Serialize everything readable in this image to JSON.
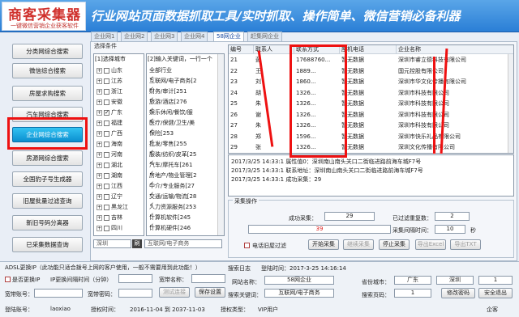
{
  "header": {
    "logo_title": "商客采集器",
    "logo_sub": "一键微信营销企业获客软件",
    "banner": "行业网站页面数据抓取工具/实时抓取、操作简单、微信营销必备利器"
  },
  "nav": {
    "items": [
      "分类网综合搜索",
      "微信综合搜索",
      "房屋求购搜索",
      "汽车网综合搜索",
      "企业网综合搜索",
      "房源网综合搜索",
      "全国豹子号生成器",
      "旧屋批量过滤查询",
      "新旧号码分离器",
      "已采集数据查询"
    ],
    "active_index": 4
  },
  "tabs": [
    "企业网1",
    "企业网2",
    "企业网3",
    "企业网4",
    "58网企业",
    "赶集网企业"
  ],
  "active_tab": 4,
  "select_condition_label": "选择条件",
  "cities": {
    "header": "[1]选择城市",
    "items": [
      {
        "name": "山东",
        "checked": false
      },
      {
        "name": "江苏",
        "checked": false
      },
      {
        "name": "浙江",
        "checked": false
      },
      {
        "name": "安徽",
        "checked": false
      },
      {
        "name": "广东",
        "checked": true
      },
      {
        "name": "福建",
        "checked": false
      },
      {
        "name": "广西",
        "checked": false
      },
      {
        "name": "海南",
        "checked": false
      },
      {
        "name": "河南",
        "checked": false
      },
      {
        "name": "湖北",
        "checked": false
      },
      {
        "name": "湖南",
        "checked": false
      },
      {
        "name": "江西",
        "checked": false
      },
      {
        "name": "辽宁",
        "checked": false
      },
      {
        "name": "黑龙江",
        "checked": false
      },
      {
        "name": "吉林",
        "checked": false
      },
      {
        "name": "四川",
        "checked": false
      }
    ],
    "search_value": "深圳",
    "search_badge": "刷"
  },
  "industries": {
    "header": "[2]输入关键词，一行一个",
    "items": [
      {
        "name": "全部行业",
        "checked": false
      },
      {
        "name": "互联网/电子商务[2",
        "checked": true
      },
      {
        "name": "财务/审计[251",
        "checked": true
      },
      {
        "name": "旅游/酒店[276",
        "checked": true
      },
      {
        "name": "娱乐休闲/餐饮/服",
        "checked": true
      },
      {
        "name": "医疗/保健/卫生/美",
        "checked": true
      },
      {
        "name": "保险[253",
        "checked": true
      },
      {
        "name": "批发/零售[255",
        "checked": true
      },
      {
        "name": "服装/纺织/皮革[25",
        "checked": true
      },
      {
        "name": "汽车/摩托车[261",
        "checked": true
      },
      {
        "name": "房地产/物业管理[2",
        "checked": true
      },
      {
        "name": "中介/专业服务[27",
        "checked": true
      },
      {
        "name": "交通/运输/物流[28",
        "checked": true
      },
      {
        "name": "人力资源服务[253",
        "checked": true
      },
      {
        "name": "计算机软件[245",
        "checked": true
      },
      {
        "name": "计算机硬件[246",
        "checked": true
      }
    ],
    "keyword_value": "互联网/电子商务"
  },
  "table": {
    "columns": [
      "编号",
      "联系人",
      "联系方式",
      "座机电话",
      "企业名称"
    ],
    "rows": [
      [
        "21",
        "彭",
        "17688760...",
        "暂无数据",
        "深圳市睿立德科技有限公司"
      ],
      [
        "22",
        "王",
        "1889...",
        "暂无数据",
        "国元控股有限公司"
      ],
      [
        "23",
        "刘",
        "1860...",
        "暂无数据",
        "深圳市华文化传播有限公司"
      ],
      [
        "24",
        "胡",
        "1326...",
        "暂无数据",
        "深圳市科技有限公司"
      ],
      [
        "25",
        "朱",
        "1326...",
        "暂无数据",
        "深圳市科技有限公司"
      ],
      [
        "26",
        "谢",
        "1326...",
        "暂无数据",
        "深圳市科技有限公司"
      ],
      [
        "27",
        "朱",
        "1326...",
        "暂无数据",
        "深圳市科技有限公司"
      ],
      [
        "28",
        "郑",
        "1596...",
        "暂无数据",
        "深圳市快乐礼品有限公司"
      ],
      [
        "29",
        "张",
        "1326...",
        "暂无数据",
        "深圳文化传播有限公司"
      ]
    ]
  },
  "log": [
    "2017/3/25 14:33:1  属性值0：深圳南山南头关口二街临进路前海车城F7号",
    "2017/3/25 14:33:1  联系地址：深圳南山南头关口二街临进路前海车城F7号",
    "2017/3/25 14:33:1  成功采集：29"
  ],
  "operation": {
    "title": "采集操作",
    "success_label": "成功采集：",
    "success_value": "29",
    "filtered_label": "已过滤重复数：",
    "filtered_value": "2",
    "current_value": "39",
    "interval_label": "采集间隔时间：",
    "interval_value": "10",
    "interval_unit": "秒",
    "buttons": {
      "start": "开始采集",
      "continue": "继续采集",
      "stop": "停止采集",
      "export_excel": "导出Excel",
      "export_txt": "导出TXT"
    },
    "filter_checkbox_label": "电话旧屋过滤"
  },
  "bottom": {
    "adsl_notice": "ADSL更换IP（此功能只适合拨号上网的客户使用，一般不需要用到此功能！）",
    "auto_change_ip_label": "是否更换IP",
    "ip_interval_label": "IP更换间隔时间（分钟）",
    "broadband_name_label": "宽带名称：",
    "broadband_account_label": "宽带账号：",
    "broadband_password_label": "宽带密码：",
    "test_connect_label": "测试连接",
    "save_settings_label": "保存设置",
    "search_log_label": "搜索日志",
    "search_log_value": "登陆时间：2017-3-25 14:16:14",
    "site_name_label": "网站名称：",
    "site_name_value": "58网企业",
    "province_label": "省份城市：",
    "province_value": "广东",
    "city_value": "深圳",
    "city_page": "1",
    "keyword_label": "搜索关键词：",
    "keyword_value": "互联网/电子商务",
    "page_label": "搜索页码：",
    "page_value": "1",
    "change_password_label": "修改密码",
    "logout_label": "安全退出",
    "login_account_label": "登陆账号：",
    "login_account_value": "laoxiao",
    "auth_time_label": "授权时间：",
    "auth_time_value": "2016-11-04 到 2037-11-03",
    "auth_type_label": "授权类型：",
    "auth_type_value": "VIP用户",
    "copyright": "企客"
  }
}
